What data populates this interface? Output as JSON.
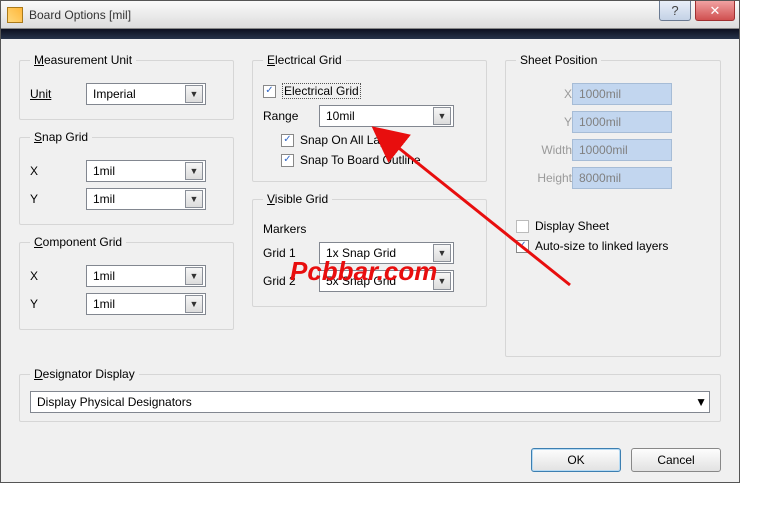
{
  "title": "Board Options [mil]",
  "measurement_unit": {
    "legend_pre": "M",
    "legend_rest": "easurement Unit",
    "unit_label": "Unit",
    "unit_value": "Imperial"
  },
  "snap_grid": {
    "legend_pre": "S",
    "legend_rest": "nap Grid",
    "x_label": "X",
    "x_value": "1mil",
    "y_label": "Y",
    "y_value": "1mil"
  },
  "component_grid": {
    "legend_pre": "C",
    "legend_rest": "omponent Grid",
    "x_label": "X",
    "x_value": "1mil",
    "y_label": "Y",
    "y_value": "1mil"
  },
  "electrical_grid": {
    "legend_pre": "E",
    "legend_rest": "lectrical Grid",
    "enable_label": "Electrical Grid",
    "enable_checked": true,
    "range_label": "Range",
    "range_value": "10mil",
    "snap_all_label": "Snap On All Layer",
    "snap_all_checked": true,
    "snap_board_label": "Snap To Board Outline",
    "snap_board_checked": true
  },
  "visible_grid": {
    "legend_pre": "V",
    "legend_rest": "isible Grid",
    "markers_label": "Markers",
    "grid1_label": "Grid 1",
    "grid1_value": "1x Snap Grid",
    "grid2_label": "Grid 2",
    "grid2_value": "5x Snap Grid"
  },
  "sheet_position": {
    "legend": "Sheet Position",
    "x_label": "X",
    "x_value": "1000mil",
    "y_label": "Y",
    "y_value": "1000mil",
    "width_label": "Width",
    "width_value": "10000mil",
    "height_label": "Height",
    "height_value": "8000mil",
    "display_sheet_label": "Display Sheet",
    "display_sheet_checked": false,
    "autosize_label": "Auto-size to linked layers",
    "autosize_checked": true
  },
  "designator": {
    "legend_pre": "D",
    "legend_rest": "esignator Display",
    "value": "Display Physical Designators"
  },
  "buttons": {
    "ok": "OK",
    "cancel": "Cancel"
  },
  "watermark": "Pcbbar.com"
}
